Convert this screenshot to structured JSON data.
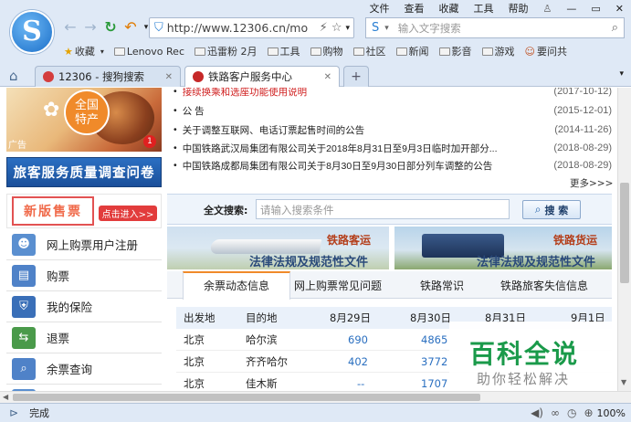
{
  "browser": {
    "menu": [
      "文件",
      "查看",
      "收藏",
      "工具",
      "帮助"
    ],
    "url": "http://www.12306.cn/mo",
    "search_placeholder": "输入文字搜索",
    "favorites": [
      {
        "label": "收藏",
        "icon": "star-icon"
      },
      {
        "label": "Lenovo Rec",
        "icon": "folder-icon"
      },
      {
        "label": "迅雷粉 2月",
        "icon": "folder-icon"
      },
      {
        "label": "工具",
        "icon": "folder-icon"
      },
      {
        "label": "购物",
        "icon": "folder-icon"
      },
      {
        "label": "社区",
        "icon": "folder-icon"
      },
      {
        "label": "新闻",
        "icon": "folder-icon"
      },
      {
        "label": "影音",
        "icon": "folder-icon"
      },
      {
        "label": "游戏",
        "icon": "folder-icon"
      },
      {
        "label": "要问共",
        "icon": "person-icon"
      }
    ],
    "tabs": [
      {
        "label": "12306 - 搜狗搜索"
      },
      {
        "label": "铁路客户服务中心"
      }
    ],
    "new_tab": "+",
    "status": "完成",
    "zoom": "100%"
  },
  "ad": {
    "badge_line1": "全国",
    "badge_line2": "特产",
    "tag": "广告",
    "count": "1"
  },
  "survey_banner": "旅客服务质量调查问卷",
  "new_ticket": {
    "title": "新版售票",
    "cta": "点击进入>>"
  },
  "sidebar": [
    {
      "label": "网上购票用户注册",
      "icon": "user-register-icon"
    },
    {
      "label": "购票",
      "icon": "ticket-icon"
    },
    {
      "label": "我的保险",
      "icon": "insurance-icon"
    },
    {
      "label": "退票",
      "icon": "refund-icon"
    },
    {
      "label": "余票查询",
      "icon": "query-icon"
    }
  ],
  "news": [
    {
      "title": "接续换乘和选座功能使用说明",
      "date": "(2017-10-12)",
      "red": true
    },
    {
      "title": "公 告",
      "date": "(2015-12-01)",
      "red": false
    },
    {
      "title": "关于调整互联网、电话订票起售时间的公告",
      "date": "(2014-11-26)",
      "red": false
    },
    {
      "title": "中国铁路武汉局集团有限公司关于2018年8月31日至9月3日临时加开部分...",
      "date": "(2018-08-29)",
      "red": false
    },
    {
      "title": "中国铁路成都局集团有限公司关于8月30日至9月30日部分列车调整的公告",
      "date": "(2018-08-29)",
      "red": false
    }
  ],
  "more": "更多>>>",
  "fulltext": {
    "label": "全文搜索:",
    "placeholder": "请输入搜索条件",
    "button": "搜 索"
  },
  "banners": [
    {
      "tag": "铁路客运",
      "caption": "法律法规及规范性文件"
    },
    {
      "tag": "铁路货运",
      "caption": "法律法规及规范性文件"
    }
  ],
  "info_tabs": [
    "余票动态信息",
    "网上购票常见问题",
    "铁路常识",
    "铁路旅客失信信息"
  ],
  "ticket_table": {
    "headers": [
      "出发地",
      "目的地",
      "8月29日",
      "8月30日",
      "8月31日",
      "9月1日"
    ],
    "rows": [
      [
        "北京",
        "哈尔滨",
        "690",
        "4865",
        "",
        ""
      ],
      [
        "北京",
        "齐齐哈尔",
        "402",
        "3772",
        "",
        ""
      ],
      [
        "北京",
        "佳木斯",
        "--",
        "1707",
        "",
        ""
      ]
    ]
  },
  "watermark": {
    "title": "百科全说",
    "subtitle": "助你轻松解决"
  }
}
